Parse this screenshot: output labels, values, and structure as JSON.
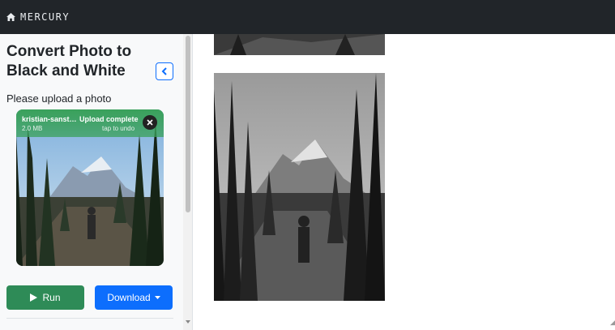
{
  "navbar": {
    "brand": "MERCURY",
    "icon": "home-icon"
  },
  "sidebar": {
    "title": "Convert Photo to Black and White",
    "upload_label": "Please upload a photo",
    "upload": {
      "file_name": "kristian-sanstr...",
      "file_size": "2.0 MB",
      "status": "Upload complete",
      "hint": "tap to undo"
    },
    "run_label": "Run",
    "download_label": "Download"
  },
  "colors": {
    "navbar": "#212529",
    "run": "#2e8b57",
    "download": "#0d6efd",
    "upload_success": "#3aa15b"
  }
}
